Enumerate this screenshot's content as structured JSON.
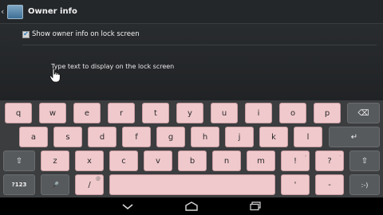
{
  "action_bar": {
    "title": "Owner info",
    "back_glyph": "‹"
  },
  "owner_info": {
    "checkbox_label": "Show owner info on lock screen",
    "checked": true,
    "check_glyph": "✔",
    "placeholder": "Type text to display on the lock screen"
  },
  "keyboard": {
    "row1": [
      "q",
      "w",
      "e",
      "r",
      "t",
      "y",
      "u",
      "i",
      "o",
      "p"
    ],
    "row2": [
      "a",
      "s",
      "d",
      "f",
      "g",
      "h",
      "j",
      "k",
      "l"
    ],
    "row3": [
      "z",
      "x",
      "c",
      "v",
      "b",
      "n",
      "m",
      "!",
      "?"
    ],
    "row3_subs": [
      "",
      "",
      "",
      "",
      "",
      "",
      "",
      ",",
      "."
    ],
    "delete_glyph": "⌫",
    "enter_glyph": "↵",
    "shift_glyph": "⇧",
    "numbers_label": "?123",
    "mic_glyph": "🎤",
    "slash_label": "/",
    "slash_sub": "@",
    "apostrophe_label": "'",
    "hyphen_label": "-",
    "emoticon_label": ":-)"
  },
  "colors": {
    "key_letter": "#f0c9cc",
    "key_function": "#575a5d",
    "accent": "#2a7fc4"
  }
}
